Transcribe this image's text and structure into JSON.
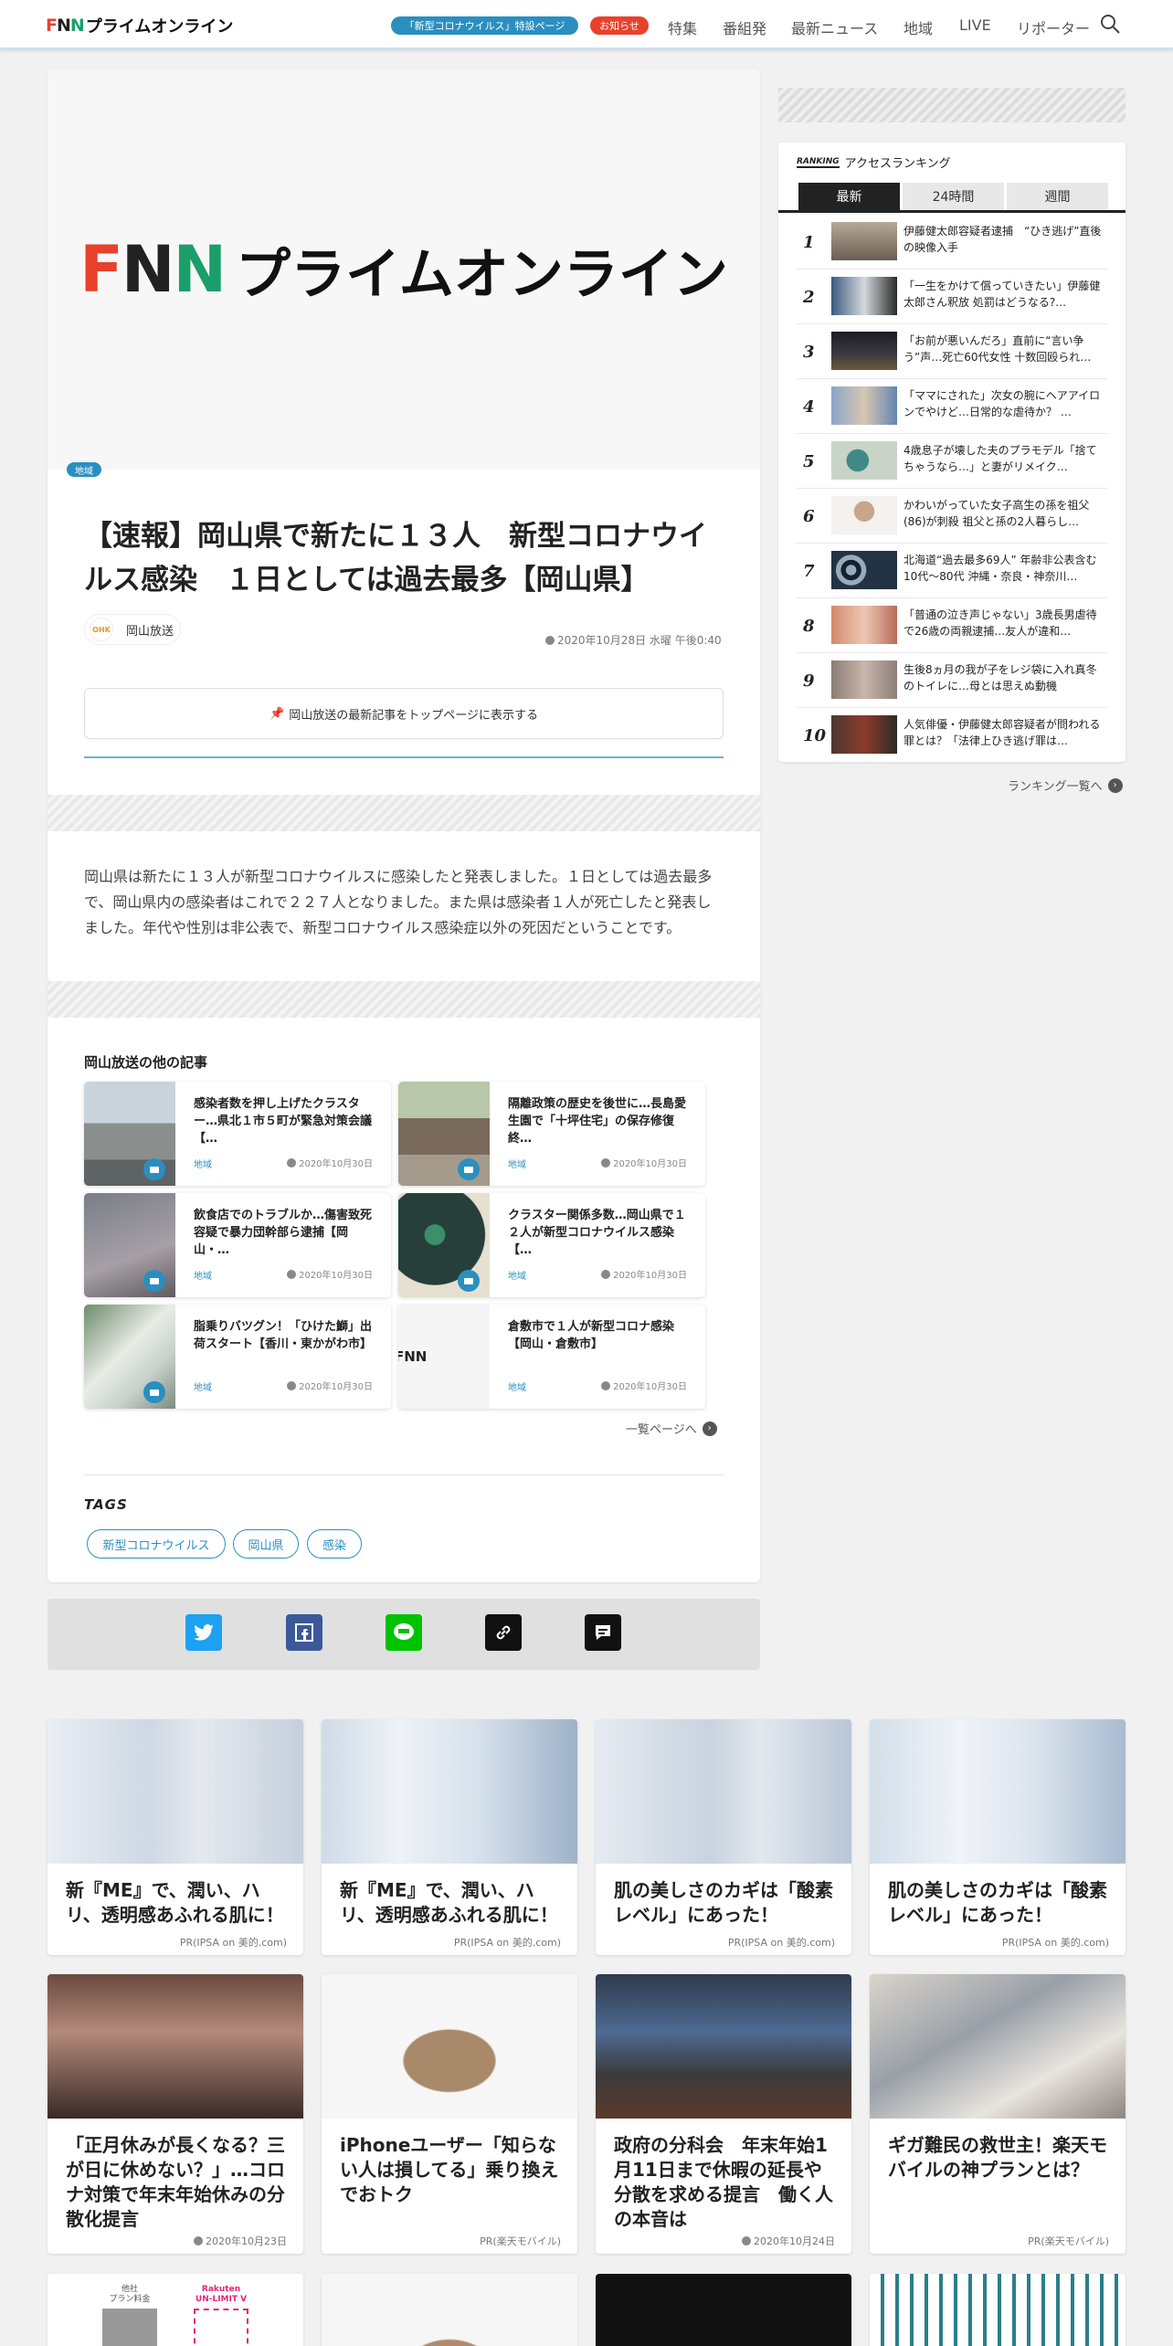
{
  "header": {
    "logo_mark": "FNN",
    "logo_text": "プライムオンライン",
    "corona_pill": "「新型コロナウイルス」特設ページ",
    "info_pill": "お知らせ",
    "nav": [
      "特集",
      "番組発",
      "最新ニュース",
      "地域",
      "LIVE",
      "リポーター"
    ]
  },
  "article": {
    "hero_logo_mark": "FNN",
    "hero_logo_text": "プライムオンライン",
    "category": "地域",
    "headline": "【速報】岡山県で新たに１３人　新型コロナウイルス感染　１日としては過去最多【岡山県】",
    "source_icon": "OHK",
    "source": "岡山放送",
    "date": "2020年10月28日 水曜 午後0:40",
    "pin_label": "岡山放送の最新記事をトップページに表示する",
    "body": "岡山県は新たに１３人が新型コロナウイルスに感染したと発表しました。１日としては過去最多で、岡山県内の感染者はこれで２２７人となりました。また県は感染者１人が死亡したと発表しました。年代や性別は非公表で、新型コロナウイルス感染症以外の死因だということです。",
    "other_title": "岡山放送の他の記事",
    "other_articles": [
      {
        "title": "感染者数を押し上げたクラスター…県北１市５町が緊急対策会議【…",
        "category": "地域",
        "date": "2020年10月30日"
      },
      {
        "title": "隔離政策の歴史を後世に…長島愛生園で「十坪住宅」の保存修復終…",
        "category": "地域",
        "date": "2020年10月30日"
      },
      {
        "title": "飲食店でのトラブルか…傷害致死容疑で暴力団幹部ら逮捕【岡山・…",
        "category": "地域",
        "date": "2020年10月30日"
      },
      {
        "title": "クラスター関係多数…岡山県で１２人が新型コロナウイルス感染【…",
        "category": "地域",
        "date": "2020年10月30日"
      },
      {
        "title": "脂乗りバツグン！「ひけた鰤」出荷スタート【香川・東かがわ市】",
        "category": "地域",
        "date": "2020年10月30日"
      },
      {
        "title": "倉敷市で１人が新型コロナ感染【岡山・倉敷市】",
        "category": "地域",
        "date": "2020年10月30日"
      }
    ],
    "more_label": "一覧ページへ",
    "tags_title": "TAGS",
    "tags": [
      "新型コロナウイルス",
      "岡山県",
      "感染"
    ]
  },
  "ranking": {
    "logo": "RANKING",
    "title": "アクセスランキング",
    "tabs": [
      "最新",
      "24時間",
      "週間"
    ],
    "items": [
      {
        "rank": "1",
        "title": "伊藤健太郎容疑者逮捕　“ひき逃げ”直後の映像入手"
      },
      {
        "rank": "2",
        "title": "「一生をかけて償っていきたい」伊藤健太郎さん釈放 処罰はどうなる?…"
      },
      {
        "rank": "3",
        "title": "「お前が悪いんだろ」直前に“言い争う”声…死亡60代女性 十数回殴られ…"
      },
      {
        "rank": "4",
        "title": "「ママにされた」次女の腕にヘアアイロンでやけど…日常的な虐待か？ …"
      },
      {
        "rank": "5",
        "title": "4歳息子が壊した夫のプラモデル「捨てちゃうなら…」と妻がリメイク…"
      },
      {
        "rank": "6",
        "title": "かわいがっていた女子高生の孫を祖父(86)が刺殺 祖父と孫の2人暮らし…"
      },
      {
        "rank": "7",
        "title": "北海道“過去最多69人” 年齢非公表含む10代～80代 沖縄・奈良・神奈川…"
      },
      {
        "rank": "8",
        "title": "「普通の泣き声じゃない」3歳長男虐待で26歳の両親逮捕…友人が違和…"
      },
      {
        "rank": "9",
        "title": "生後8ヵ月の我が子をレジ袋に入れ真冬のトイレに…母とは思えぬ動機"
      },
      {
        "rank": "10",
        "title": "人気俳優・伊藤健太郎容疑者が問われる罪とは？「法律上ひき逃げ罪は…"
      }
    ],
    "more_label": "ランキング一覧へ"
  },
  "pr_cards": [
    {
      "title": "新『ME』で、潤い、ハリ、透明感あふれる肌に！",
      "source": "PR(IPSA on 美的.com)"
    },
    {
      "title": "新『ME』で、潤い、ハリ、透明感あふれる肌に！",
      "source": "PR(IPSA on 美的.com)"
    },
    {
      "title": "肌の美しさのカギは「酸素レベル」にあった！",
      "source": "PR(IPSA on 美的.com)"
    },
    {
      "title": "肌の美しさのカギは「酸素レベル」にあった！",
      "source": "PR(IPSA on 美的.com)"
    },
    {
      "title": "「正月休みが長くなる？三が日に休めない？」…コロナ対策で年末年始休みの分散化提言",
      "source": "2020年10月23日"
    },
    {
      "title": "iPhoneユーザー「知らない人は損してる」乗り換えでおトク",
      "source": "PR(楽天モバイル)"
    },
    {
      "title": "政府の分科会　年末年始1月11日まで休暇の延長や分散を求める提言　働く人の本音は",
      "source": "2020年10月24日"
    },
    {
      "title": "ギガ難民の救世主！楽天モバイルの神プランとは？",
      "source": "PR(楽天モバイル)"
    }
  ],
  "partial_cards": {
    "chart_label_1": "他社\nプラン料金",
    "chart_label_2": "Rakuten\nUN-LIMIT V"
  },
  "colors": {
    "accent": "#2a8fc0",
    "alert": "#e8412c",
    "brand_green": "#1b9f6a",
    "twitter": "#1da1f2",
    "facebook": "#3b5998",
    "line": "#00c300"
  }
}
